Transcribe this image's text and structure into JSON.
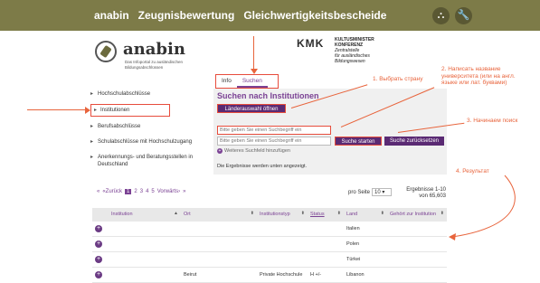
{
  "topnav": {
    "items": [
      "anabin",
      "Zeugnisbewertung",
      "Gleichwertigkeitsbescheide"
    ],
    "icons": [
      "sitemap-icon",
      "wrench-icon"
    ]
  },
  "logo": {
    "name": "anabin",
    "subtitle": "Das Infoportal zu ausländischen Bildungsabschlüssen"
  },
  "kmk": {
    "mark": "KMK",
    "line1": "KULTUSMINISTER",
    "line2": "KONFERENZ",
    "line3": "Zentralstelle",
    "line4": "für ausländisches",
    "line5": "Bildungswesen"
  },
  "tabs": [
    "Info",
    "Suchen"
  ],
  "sidebar": {
    "items": [
      "Hochschulabschlüsse",
      "Institutionen",
      "Berufsabschlüsse",
      "Schulabschlüsse mit Hochschulzugang",
      "Anerkennungs- und Beratungsstellen in Deutschland"
    ]
  },
  "search": {
    "title": "Suchen nach Institutionen",
    "country_button": "Länderauswahl öffnen",
    "placeholder1": "Bitte geben Sie einen Suchbegriff ein",
    "placeholder2": "Bitte geben Sie einen Suchbegriff ein",
    "start_button": "Suche starten",
    "reset_button": "Suche zurücksetzen",
    "more_field": "Weiteres Suchfeld hinzufügen",
    "results_note": "Die Ergebnisse werden unten angezeigt."
  },
  "annotations": {
    "a1": "1. Выбрать страну",
    "a2": "2. Написать название университета (или на англ. языке или лат. буквами)",
    "a3": "3. Начинаем поиск",
    "a4": "4. Результат"
  },
  "pager": {
    "prev": "«Zurück",
    "pages": [
      "1",
      "2",
      "3",
      "4",
      "5"
    ],
    "next": "Vorwärts›",
    "last": "»",
    "first": "«"
  },
  "perpage": {
    "label": "pro Seite",
    "value": "10"
  },
  "results_count": "Ergebnisse 1-10 von 65,603",
  "table": {
    "headers": [
      "Institution",
      "Ort",
      "Institutionstyp",
      "Status",
      "Land",
      "Gehört zur Institution"
    ],
    "rows": [
      {
        "institution": "",
        "ort": "",
        "typ": "",
        "status": "",
        "land": "Italien",
        "gehoert": ""
      },
      {
        "institution": "",
        "ort": "",
        "typ": "",
        "status": "",
        "land": "Polen",
        "gehoert": ""
      },
      {
        "institution": "",
        "ort": "",
        "typ": "",
        "status": "",
        "land": "Türkei",
        "gehoert": ""
      },
      {
        "institution": "",
        "ort": "Beirut",
        "typ": "Private Hochschule",
        "status": "H +/-",
        "land": "Libanon",
        "gehoert": ""
      }
    ]
  },
  "colors": {
    "topbar": "#7d7b48",
    "accent": "#7b4294",
    "annotation": "#e8643c"
  }
}
